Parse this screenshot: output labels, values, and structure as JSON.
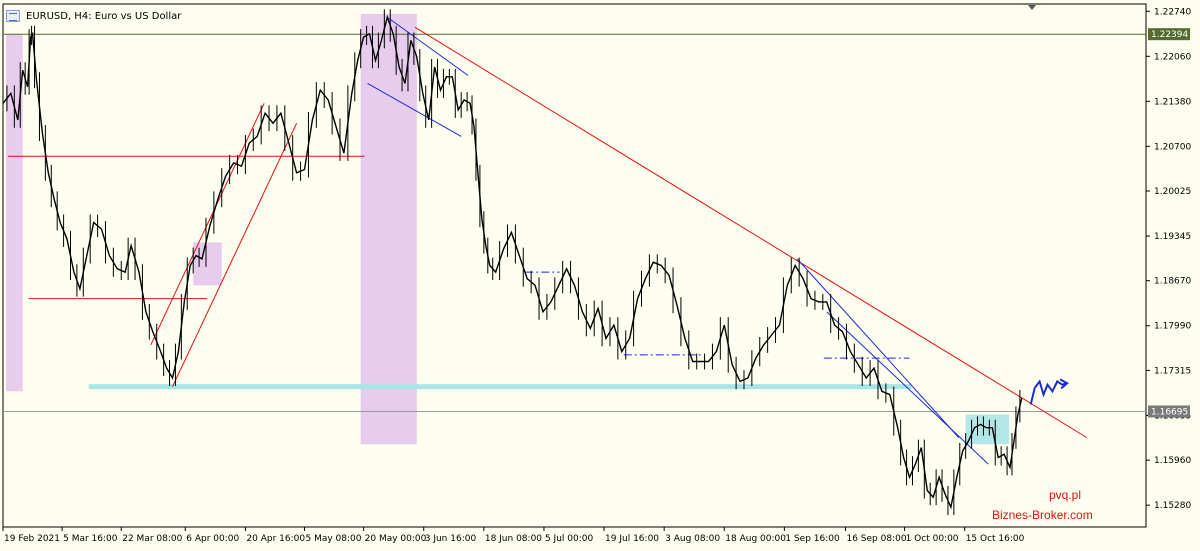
{
  "window": {
    "title": "EURUSD, H4:  Euro vs US Dollar"
  },
  "watermark": {
    "site1": "pvq.pl",
    "site2": "Biznes-Broker.com"
  },
  "colors": {
    "background": "#fefef0",
    "candles": "#000000",
    "trend": "#e01010",
    "channel": "#1a2ccc",
    "support": "#a8e6e6",
    "box": "#e6c6ec",
    "cyanbox": "#a8e6e6",
    "projection": "#1a2ccc"
  },
  "chart_data": {
    "type": "line",
    "symbol": "EURUSD",
    "timeframe": "H4",
    "title": "EURUSD, H4:  Euro vs US Dollar",
    "ylim": [
      1.1495,
      1.2285
    ],
    "xlim": [
      0,
      1160
    ],
    "current_price": "1.16695",
    "marked_price": "1.22394",
    "y_ticks": [
      "1.22740",
      "1.22060",
      "1.21380",
      "1.20700",
      "1.20025",
      "1.19345",
      "1.18670",
      "1.17990",
      "1.17315",
      "1.16635",
      "1.15960",
      "1.15280"
    ],
    "y_tick_values": [
      1.2274,
      1.2206,
      1.2138,
      1.207,
      1.20025,
      1.19345,
      1.1867,
      1.1799,
      1.17315,
      1.16635,
      1.1596,
      1.1528
    ],
    "x_ticks": [
      "19 Feb 2021",
      "5 Mar 16:00",
      "22 Mar 08:00",
      "6 Apr 00:00",
      "20 Apr 16:00",
      "5 May 08:00",
      "20 May 00:00",
      "3 Jun 16:00",
      "18 Jun 08:00",
      "5 Jul 00:00",
      "19 Jul 16:00",
      "3 Aug 08:00",
      "18 Aug 00:00",
      "1 Sep 16:00",
      "16 Sep 08:00",
      "1 Oct 00:00",
      "15 Oct 16:00"
    ],
    "x_tick_pos": [
      0,
      60,
      120,
      185,
      246,
      306,
      366,
      427,
      488,
      549,
      610,
      671,
      732,
      793,
      855,
      915,
      976
    ],
    "series": [
      {
        "x": [
          0,
          8,
          15,
          20,
          25,
          28,
          30,
          34,
          40,
          46,
          52,
          58,
          65,
          72,
          78,
          85,
          92,
          100,
          108,
          116,
          124,
          130,
          138,
          145,
          152,
          160,
          166,
          172,
          178,
          184,
          190,
          196,
          202,
          210,
          218,
          226,
          234,
          242,
          250,
          258,
          266,
          274,
          282,
          290,
          298,
          306,
          314,
          322,
          330,
          338,
          346,
          354,
          360,
          366,
          372,
          378,
          384,
          390,
          396,
          402,
          408,
          414,
          420,
          426,
          432,
          438,
          444,
          450,
          456,
          462,
          468,
          474,
          478,
          482,
          486,
          490,
          494,
          500,
          508,
          516,
          524,
          532,
          540,
          548,
          556,
          564,
          572,
          580,
          588,
          596,
          604,
          612,
          620,
          628,
          636,
          644,
          652,
          660,
          668,
          676,
          684,
          692,
          700,
          708,
          716,
          724,
          732,
          740,
          748,
          756,
          764,
          772,
          780,
          788,
          796,
          804,
          812,
          820,
          828,
          836,
          844,
          852,
          860,
          868,
          876,
          884,
          892,
          900,
          908,
          914,
          920,
          926,
          932,
          938,
          944,
          950,
          956,
          962,
          968,
          974,
          980,
          986,
          992,
          998,
          1004,
          1010,
          1016,
          1022,
          1026,
          1030,
          1034
        ],
        "values": [
          1.2135,
          1.215,
          1.211,
          1.2185,
          1.216,
          1.2235,
          1.224,
          1.217,
          1.209,
          1.203,
          1.199,
          1.1955,
          1.193,
          1.188,
          1.1855,
          1.1905,
          1.1955,
          1.1945,
          1.1905,
          1.1885,
          1.188,
          1.192,
          1.188,
          1.182,
          1.179,
          1.176,
          1.1735,
          1.172,
          1.176,
          1.1835,
          1.189,
          1.1905,
          1.19,
          1.195,
          1.199,
          1.2025,
          1.2045,
          1.204,
          1.2075,
          1.2085,
          1.212,
          1.2105,
          1.212,
          1.2075,
          1.203,
          1.2035,
          1.211,
          1.2155,
          1.214,
          1.21,
          1.206,
          1.215,
          1.22,
          1.2235,
          1.224,
          1.22,
          1.223,
          1.2265,
          1.224,
          1.219,
          1.2165,
          1.223,
          1.2205,
          1.215,
          1.211,
          1.219,
          1.2155,
          1.2175,
          1.2175,
          1.2125,
          1.214,
          1.2135,
          1.21,
          1.203,
          1.196,
          1.192,
          1.189,
          1.188,
          1.1915,
          1.194,
          1.1905,
          1.187,
          1.186,
          1.182,
          1.1835,
          1.186,
          1.1885,
          1.186,
          1.182,
          1.1795,
          1.1825,
          1.178,
          1.18,
          1.176,
          1.178,
          1.184,
          1.187,
          1.1895,
          1.189,
          1.1875,
          1.183,
          1.178,
          1.1745,
          1.1745,
          1.1745,
          1.176,
          1.18,
          1.174,
          1.1715,
          1.172,
          1.175,
          1.177,
          1.1785,
          1.18,
          1.186,
          1.189,
          1.187,
          1.184,
          1.1835,
          1.1835,
          1.18,
          1.179,
          1.176,
          1.174,
          1.172,
          1.1735,
          1.17,
          1.1695,
          1.1645,
          1.16,
          1.157,
          1.159,
          1.1615,
          1.155,
          1.154,
          1.157,
          1.1545,
          1.1525,
          1.157,
          1.161,
          1.1625,
          1.1645,
          1.165,
          1.1645,
          1.1645,
          1.16,
          1.1605,
          1.1585,
          1.1625,
          1.1665,
          1.169
        ]
      }
    ],
    "annotations": {
      "trendline": {
        "from": [
          418,
          1.225
        ],
        "to": [
          1100,
          1.163
        ]
      },
      "resistance": {
        "from": [
          5,
          1.2055
        ],
        "to": [
          367,
          1.2055
        ]
      },
      "support_zone": {
        "from": [
          87,
          1.1707
        ],
        "to": [
          922,
          1.1707
        ]
      },
      "support_line": {
        "from": [
          26,
          1.184
        ],
        "to": [
          207,
          1.184
        ]
      },
      "channel_up": [
        {
          "from": [
            172,
            1.1707
          ],
          "to": [
            298,
            1.2105
          ]
        },
        {
          "from": [
            150,
            1.177
          ],
          "to": [
            265,
            1.2135
          ]
        }
      ],
      "channel_down": [
        {
          "from": [
            390,
            1.2265
          ],
          "to": [
            472,
            1.2177
          ]
        },
        {
          "from": [
            370,
            1.2165
          ],
          "to": [
            465,
            1.2085
          ]
        }
      ],
      "channel_down2": [
        {
          "from": [
            806,
            1.19
          ],
          "to": [
            970,
            1.163
          ]
        },
        {
          "from": [
            836,
            1.182
          ],
          "to": [
            1000,
            1.159
          ]
        }
      ],
      "dashdot_lines": [
        {
          "from": [
            530,
            1.188
          ],
          "to": [
            565,
            1.188
          ]
        },
        {
          "from": [
            630,
            1.1755
          ],
          "to": [
            710,
            1.1755
          ]
        },
        {
          "from": [
            833,
            1.175
          ],
          "to": [
            920,
            1.175
          ]
        }
      ],
      "shaded_boxes": [
        {
          "x0": 3,
          "x1": 20,
          "y0": 1.17,
          "y1": 1.224
        },
        {
          "x0": 363,
          "x1": 420,
          "y0": 1.162,
          "y1": 1.227
        },
        {
          "x0": 193,
          "x1": 222,
          "y0": 1.186,
          "y1": 1.1925
        }
      ],
      "cyan_box": {
        "x0": 977,
        "x1": 1021,
        "y0": 1.162,
        "y1": 1.1665
      },
      "projection": {
        "x": [
          1043,
          1047,
          1052,
          1056,
          1060,
          1065,
          1070,
          1075,
          1079
        ],
        "values": [
          1.168,
          1.1705,
          1.1715,
          1.1695,
          1.171,
          1.17,
          1.1715,
          1.171,
          1.1712
        ]
      }
    }
  }
}
